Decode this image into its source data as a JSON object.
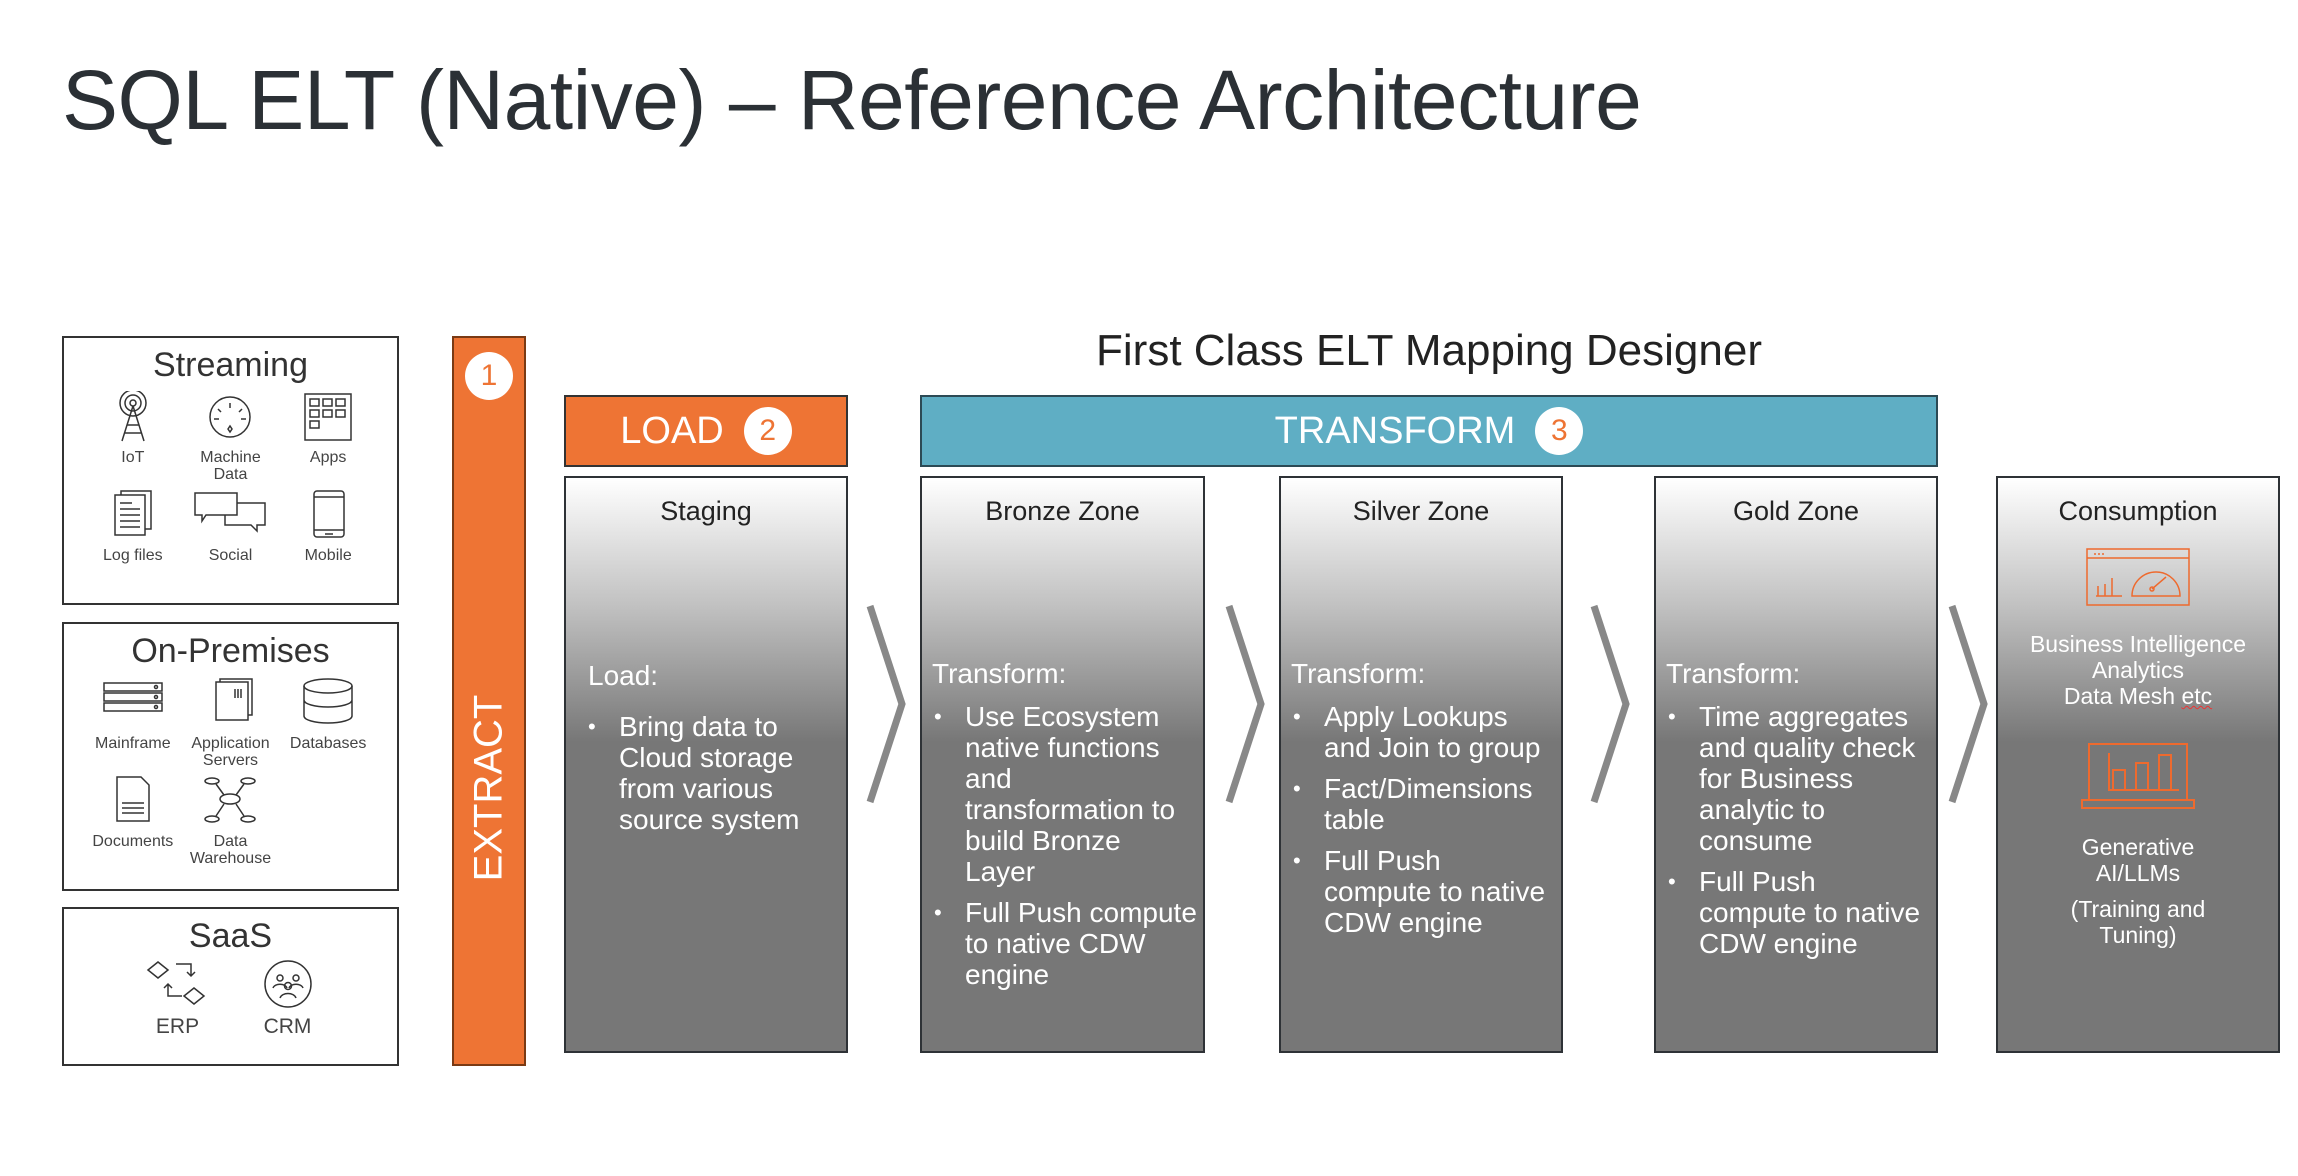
{
  "title": "SQL ELT (Native) – Reference Architecture",
  "sources": {
    "streaming": {
      "title": "Streaming",
      "items": [
        {
          "label": "IoT",
          "icon": "antenna-icon"
        },
        {
          "label": "Machine Data",
          "icon": "gauge-icon"
        },
        {
          "label": "Apps",
          "icon": "apps-grid-icon"
        },
        {
          "label": "Log files",
          "icon": "log-files-icon"
        },
        {
          "label": "Social",
          "icon": "chat-bubbles-icon"
        },
        {
          "label": "Mobile",
          "icon": "mobile-phone-icon"
        }
      ]
    },
    "onprem": {
      "title": "On-Premises",
      "items": [
        {
          "label": "Mainframe",
          "icon": "server-rack-icon"
        },
        {
          "label": "Application Servers",
          "icon": "app-server-icon"
        },
        {
          "label": "Databases",
          "icon": "database-icon"
        },
        {
          "label": "Documents",
          "icon": "document-icon"
        },
        {
          "label": "Data Warehouse",
          "icon": "data-warehouse-icon"
        }
      ]
    },
    "saas": {
      "title": "SaaS",
      "items": [
        {
          "label": "ERP",
          "icon": "erp-flow-icon"
        },
        {
          "label": "CRM",
          "icon": "crm-people-icon"
        }
      ]
    }
  },
  "extract": {
    "label": "EXTRACT",
    "step": "1"
  },
  "designer_title": "First Class ELT Mapping Designer",
  "load": {
    "label": "LOAD",
    "step": "2"
  },
  "transform": {
    "label": "TRANSFORM",
    "step": "3"
  },
  "colors": {
    "orange": "#ee7434",
    "teal": "#5faec4",
    "zone_gray": "#777777"
  },
  "zones": [
    {
      "title": "Staging",
      "heading": "Load:",
      "bullets": [
        "Bring data to Cloud storage from various source system"
      ]
    },
    {
      "title": "Bronze Zone",
      "heading": "Transform:",
      "bullets": [
        "Use Ecosystem native functions and transformation to build Bronze Layer",
        "Full Push compute to native CDW engine"
      ]
    },
    {
      "title": "Silver Zone",
      "heading": "Transform:",
      "bullets": [
        "Apply Lookups and Join to group",
        "Fact/Dimensions table",
        "Full Push compute to native CDW engine"
      ]
    },
    {
      "title": "Gold Zone",
      "heading": "Transform:",
      "bullets": [
        "Time aggregates and quality check for Business analytic to consume",
        "Full Push compute to native CDW engine"
      ]
    }
  ],
  "consumption": {
    "title": "Consumption",
    "bi": {
      "line1": "Business Intelligence",
      "line2": "Analytics",
      "line3a": "Data Mesh ",
      "line3b": "etc"
    },
    "ai": {
      "line1": "Generative",
      "line2": "AI/LLMs",
      "line3": "(Training and",
      "line4": "Tuning)"
    }
  }
}
